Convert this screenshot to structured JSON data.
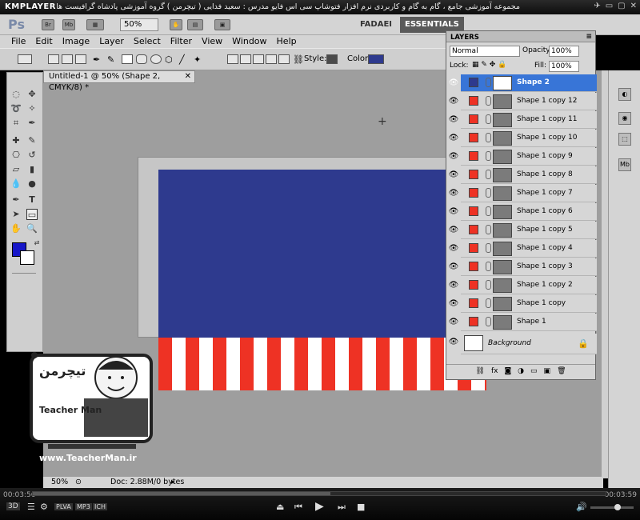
{
  "player": {
    "logo": "KMPLAYER",
    "title": "مجموعه آموزشی جامع ، گام به گام و کاربردی نرم افزار فتوشاپ سی اس فایو  مدرس : سعید فدایی ( تیچرمن ) گروه آموزشی پادشاه گرافیست ها",
    "time_elapsed": "00:03:56",
    "time_total": "00:03:59",
    "progress": 0.52,
    "badges": [
      "3D",
      "PLVA",
      "MP3",
      "ICH"
    ]
  },
  "photoshop": {
    "logo": "Ps",
    "bridge": "Br",
    "minibridge": "Mb",
    "zoom": "50%",
    "workspace_user": "FADAEI",
    "workspace_essentials": "ESSENTIALS",
    "menu": [
      "File",
      "Edit",
      "Image",
      "Layer",
      "Select",
      "Filter",
      "View",
      "Window",
      "Help"
    ],
    "options": {
      "style_label": "Style:",
      "color_label": "Color:",
      "color": "#2e3a8e"
    },
    "doc_tab": "Untitled-1 @ 50% (Shape 2, CMYK/8) *",
    "status_zoom": "50%",
    "status_doc": "Doc: 2.88M/0 bytes",
    "fg_color": "#1616c8",
    "bg_color": "#ffffff"
  },
  "layers_panel": {
    "title": "LAYERS",
    "blend_mode": "Normal",
    "opacity_label": "Opacity:",
    "opacity": "100%",
    "lock_label": "Lock:",
    "fill_label": "Fill:",
    "fill": "100%",
    "layers": [
      {
        "name": "Shape 2",
        "color": "#2e3a8e",
        "selected": true
      },
      {
        "name": "Shape 1 copy 12",
        "color": "#ee3224",
        "selected": false
      },
      {
        "name": "Shape 1 copy 11",
        "color": "#ee3224",
        "selected": false
      },
      {
        "name": "Shape 1 copy 10",
        "color": "#ee3224",
        "selected": false
      },
      {
        "name": "Shape 1 copy 9",
        "color": "#ee3224",
        "selected": false
      },
      {
        "name": "Shape 1 copy 8",
        "color": "#ee3224",
        "selected": false
      },
      {
        "name": "Shape 1 copy 7",
        "color": "#ee3224",
        "selected": false
      },
      {
        "name": "Shape 1 copy 6",
        "color": "#ee3224",
        "selected": false
      },
      {
        "name": "Shape 1 copy 5",
        "color": "#ee3224",
        "selected": false
      },
      {
        "name": "Shape 1 copy 4",
        "color": "#ee3224",
        "selected": false
      },
      {
        "name": "Shape 1 copy 3",
        "color": "#ee3224",
        "selected": false
      },
      {
        "name": "Shape 1 copy 2",
        "color": "#ee3224",
        "selected": false
      },
      {
        "name": "Shape 1 copy",
        "color": "#ee3224",
        "selected": false
      },
      {
        "name": "Shape 1",
        "color": "#ee3224",
        "selected": false
      }
    ],
    "background_layer": "Background"
  },
  "watermark": {
    "brand_fa": "تیچرمن",
    "brand_en": "Teacher Man",
    "url": "www.TeacherMan.ir"
  }
}
